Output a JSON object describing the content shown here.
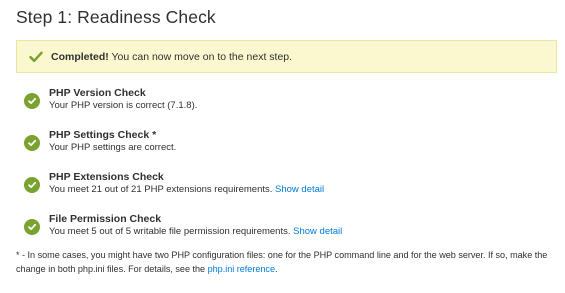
{
  "page": {
    "title": "Step 1: Readiness Check"
  },
  "banner": {
    "icon": "checkmark-icon",
    "strong": "Completed!",
    "text": " You can now move on to the next step."
  },
  "checks": [
    {
      "icon": "success-check-icon",
      "title": "PHP Version Check",
      "description": "Your PHP version is correct (7.1.8)."
    },
    {
      "icon": "success-check-icon",
      "title": "PHP Settings Check *",
      "description": "Your PHP settings are correct."
    },
    {
      "icon": "success-check-icon",
      "title": "PHP Extensions Check",
      "description": "You meet 21 out of 21 PHP extensions requirements. ",
      "link": "Show detail"
    },
    {
      "icon": "success-check-icon",
      "title": "File Permission Check",
      "description": "You meet 5 out of 5 writable file permission requirements. ",
      "link": "Show detail"
    }
  ],
  "footnote": {
    "text": "* - In some cases, you might have two PHP configuration files: one for the PHP command line and for the web server. If so, make the change in both php.ini files. For details, see the ",
    "link": "php.ini reference",
    "end": "."
  },
  "colors": {
    "success": "#79a22e",
    "banner_bg": "#fbf8cf",
    "link": "#007bdb",
    "text": "#303030"
  }
}
